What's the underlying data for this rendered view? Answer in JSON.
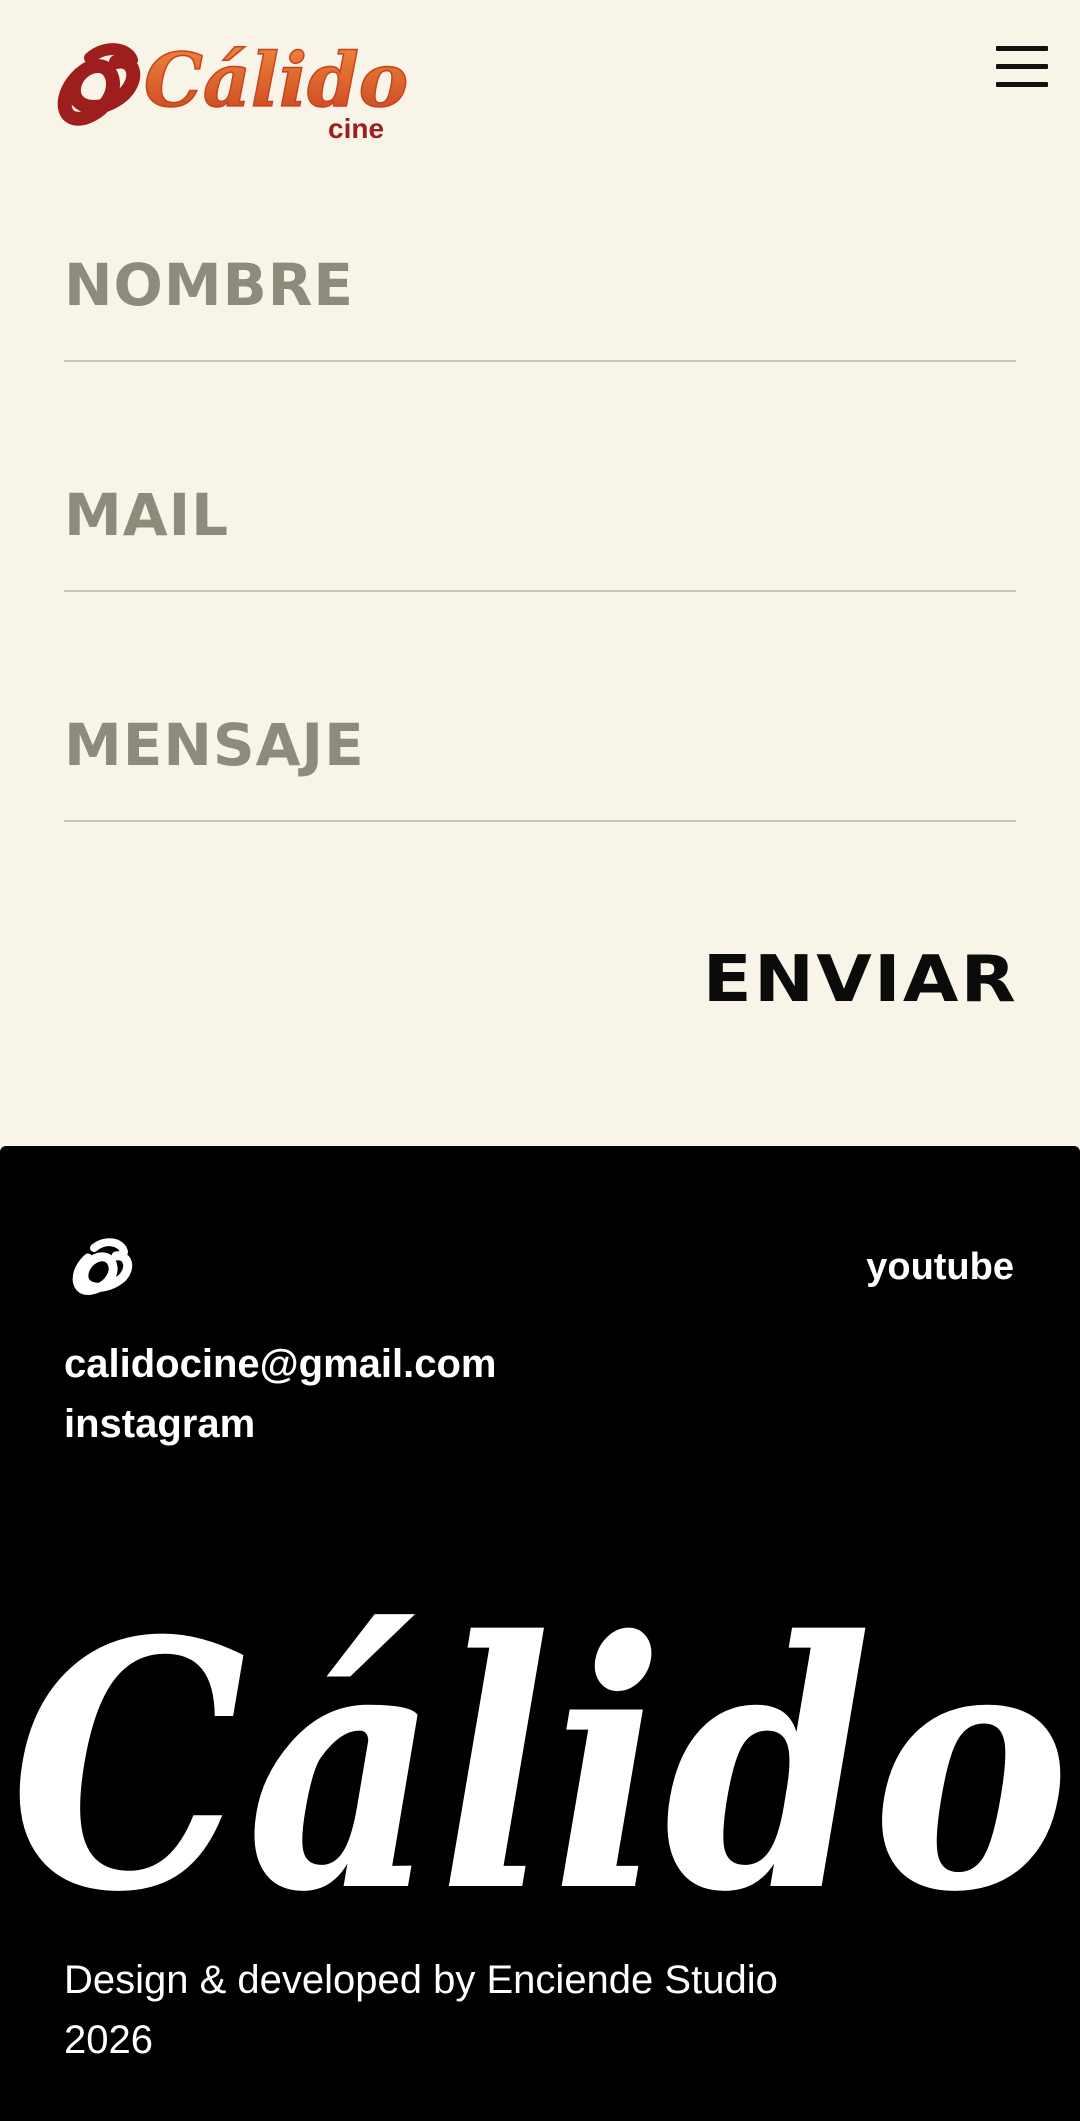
{
  "brand": {
    "name": "Cálido",
    "subtitle": "cine"
  },
  "header": {
    "menu_icon": "hamburger-menu-icon"
  },
  "form": {
    "name_placeholder": "NOMBRE",
    "email_placeholder": "MAIL",
    "message_placeholder": "MENSAJE",
    "submit_label": "ENVIAR"
  },
  "footer": {
    "mark_icon": "calido-mark-icon",
    "youtube": "youtube",
    "email": "calidocine@gmail.com",
    "instagram": "instagram",
    "wordmark": "Cálido",
    "credit_line": "Design & developed by Enciende Studio",
    "year": "2026"
  },
  "colors": {
    "background": "#f8f5e8",
    "field_text": "#8e8b7c",
    "field_rule": "#c9c8ba",
    "brand_dark_red": "#9e1d1d",
    "brand_orange": "#e0622a",
    "footer_bg": "#000000",
    "footer_text": "#ffffff"
  }
}
